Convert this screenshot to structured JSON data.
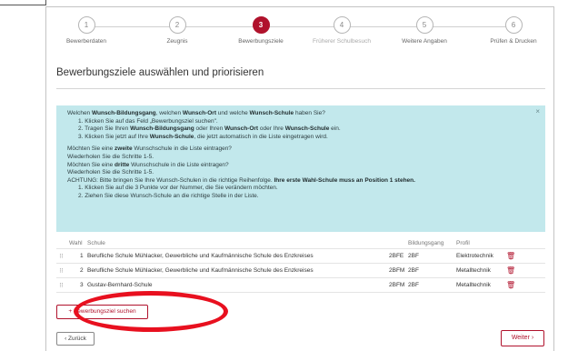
{
  "stepper": {
    "steps": [
      {
        "num": "1",
        "label": "Bewerberdaten"
      },
      {
        "num": "2",
        "label": "Zeugnis"
      },
      {
        "num": "3",
        "label": "Bewerbungsziele"
      },
      {
        "num": "4",
        "label": "Früherer Schulbesuch"
      },
      {
        "num": "5",
        "label": "Weitere Angaben"
      },
      {
        "num": "6",
        "label": "Prüfen & Drucken"
      }
    ],
    "active_step": 3
  },
  "page": {
    "title": "Bewerbungsziele auswählen und priorisieren"
  },
  "info": {
    "l1_a": "Welchen ",
    "l1_b": "Wunsch-Bildungsgang",
    "l1_c": ", welchen ",
    "l1_d": "Wunsch-Ort",
    "l1_e": " und welche ",
    "l1_f": "Wunsch-Schule",
    "l1_g": " haben Sie?",
    "s1": "1. Klicken Sie auf das Feld „Bewerbungsziel suchen\".",
    "s2_a": "2. Tragen Sie Ihren ",
    "s2_b": "Wunsch-Bildungsgang",
    "s2_c": " oder Ihren ",
    "s2_d": "Wunsch-Ort",
    "s2_e": " oder Ihre ",
    "s2_f": "Wunsch-Schule",
    "s2_g": " ein.",
    "s3_a": "3. Klicken Sie jetzt auf Ihre ",
    "s3_b": "Wunsch-Schule",
    "s3_c": ", die jetzt automatisch in die Liste eingetragen wird.",
    "m1_a": "Möchten Sie eine ",
    "m1_b": "zweite",
    "m1_c": " Wunschschule in die Liste eintragen?",
    "m2": "Wiederholen Sie die Schritte 1-5.",
    "m3_a": "Möchten Sie eine ",
    "m3_b": "dritte",
    "m3_c": " Wunschschule in die Liste eintragen?",
    "m4": "Wiederholen Sie die Schritte 1-5.",
    "w_a": "ACHTUNG: Bitte bringen Sie Ihre Wunsch-Schulen in die richtige Reihenfolge. ",
    "w_b": "Ihre erste Wahl-Schule muss an Position 1 stehen.",
    "w1": "1. Klicken Sie auf die 3 Punkte vor der Nummer, die Sie verändern möchten.",
    "w2": "2. Ziehen Sie diese Wunsch-Schule an die richtige Stelle in der Liste.",
    "close": "×"
  },
  "table": {
    "headers": {
      "wahl": "Wahl",
      "schule": "Schule",
      "bildungsgang": "Bildungsgang",
      "profil": "Profil"
    },
    "rows": [
      {
        "drag": "⠿",
        "wahl": "1",
        "schule": "Berufliche Schule Mühlacker, Gewerbliche und Kaufmännische Schule des Enzkreises",
        "code": "2BFE",
        "bildungsgang": "2BF",
        "profil": "Elektrotechnik"
      },
      {
        "drag": "⠿",
        "wahl": "2",
        "schule": "Berufliche Schule Mühlacker, Gewerbliche und Kaufmännische Schule des Enzkreises",
        "code": "2BFM",
        "bildungsgang": "2BF",
        "profil": "Metalltechnik"
      },
      {
        "drag": "⠿",
        "wahl": "3",
        "schule": "Gustav-Bernhard-Schule",
        "code": "2BFM",
        "bildungsgang": "2BF",
        "profil": "Metalltechnik"
      }
    ]
  },
  "buttons": {
    "search": "+ Bewerbungsziel suchen",
    "back": "‹ Zurück",
    "next": "Weiter ›"
  },
  "colors": {
    "accent": "#b0122c",
    "info_bg": "#c2e8ec",
    "highlight": "#e8101f"
  }
}
